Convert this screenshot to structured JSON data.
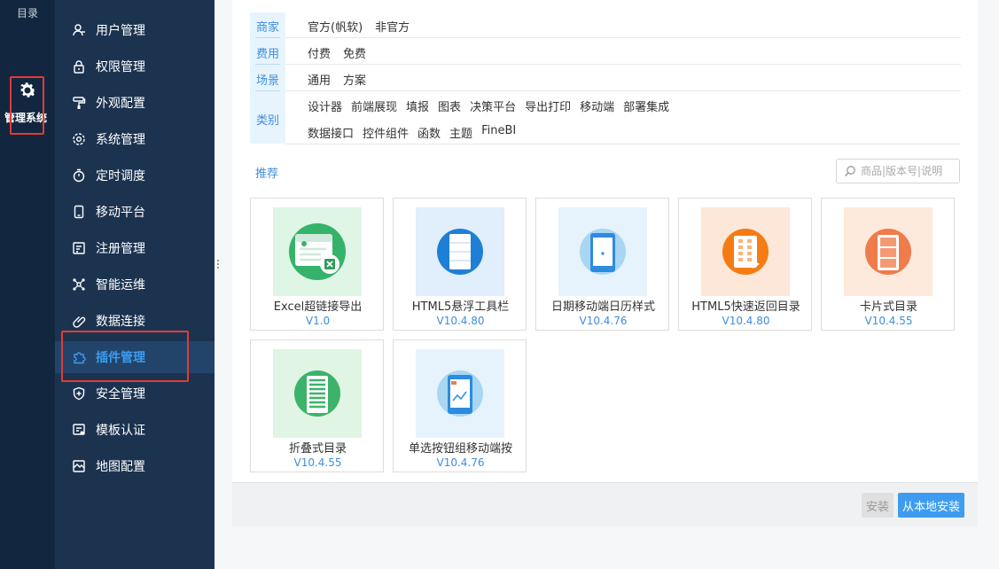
{
  "rail": {
    "catalog_label": "目录",
    "admin_label": "管理系统"
  },
  "menu": {
    "items": [
      {
        "label": "用户管理",
        "icon": "user-icon"
      },
      {
        "label": "权限管理",
        "icon": "lock-icon"
      },
      {
        "label": "外观配置",
        "icon": "paint-roller-icon"
      },
      {
        "label": "系统管理",
        "icon": "gear-icon"
      },
      {
        "label": "定时调度",
        "icon": "timer-icon"
      },
      {
        "label": "移动平台",
        "icon": "mobile-icon"
      },
      {
        "label": "注册管理",
        "icon": "register-icon"
      },
      {
        "label": "智能运维",
        "icon": "ops-icon"
      },
      {
        "label": "数据连接",
        "icon": "link-icon"
      },
      {
        "label": "插件管理",
        "icon": "puzzle-icon",
        "active": true
      },
      {
        "label": "安全管理",
        "icon": "shield-icon"
      },
      {
        "label": "模板认证",
        "icon": "certificate-icon"
      },
      {
        "label": "地图配置",
        "icon": "map-icon"
      }
    ]
  },
  "filters": {
    "vendor": {
      "key": "商家",
      "values": [
        "官方(帆软)",
        "非官方"
      ]
    },
    "cost": {
      "key": "费用",
      "values": [
        "付费",
        "免费"
      ]
    },
    "scene": {
      "key": "场景",
      "values": [
        "通用",
        "方案"
      ]
    },
    "category": {
      "key": "类别",
      "values_row1": [
        "设计器",
        "前端展现",
        "填报",
        "图表",
        "决策平台",
        "导出打印",
        "移动端",
        "部署集成"
      ],
      "values_row2": [
        "数据接口",
        "控件组件",
        "函数",
        "主题",
        "FineBI"
      ]
    }
  },
  "recommend_label": "推荐",
  "search": {
    "placeholder": "商品|版本号|说明"
  },
  "plugins": [
    {
      "name": "Excel超链接导出",
      "version": "V1.0",
      "theme": "green"
    },
    {
      "name": "HTML5悬浮工具栏",
      "version": "V10.4.80",
      "theme": "blue"
    },
    {
      "name": "日期移动端日历样式",
      "version": "V10.4.76",
      "theme": "lightblue"
    },
    {
      "name": "HTML5快速返回目录",
      "version": "V10.4.80",
      "theme": "orange"
    },
    {
      "name": "卡片式目录",
      "version": "V10.4.55",
      "theme": "peach"
    },
    {
      "name": "折叠式目录",
      "version": "V10.4.55",
      "theme": "green2"
    },
    {
      "name": "单选按钮组移动端按",
      "version": "V10.4.76",
      "theme": "lightblue2"
    }
  ],
  "footer": {
    "install_label": "安装",
    "local_install_label": "从本地安装"
  },
  "colors": {
    "rail_bg": "#12273f",
    "menu_bg": "#1c3350",
    "accent": "#3d9cf0",
    "highlight_box": "#e53935"
  }
}
